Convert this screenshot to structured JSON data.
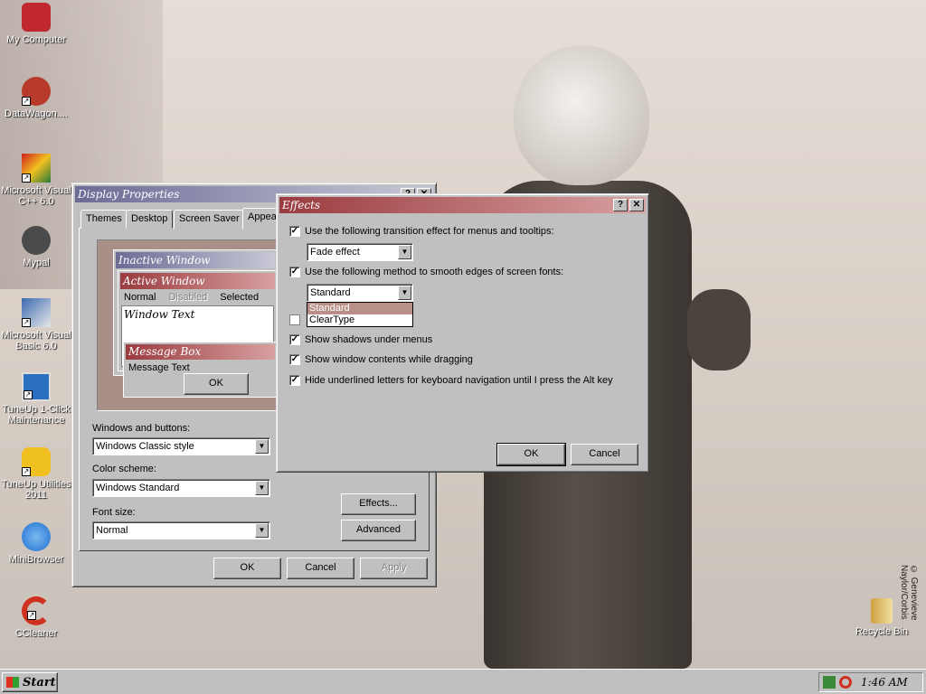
{
  "desktop": {
    "icons": [
      {
        "label": "My Computer",
        "icon": "briefcase-icon",
        "color": "#c0282d"
      },
      {
        "label": "DataWagon....",
        "icon": "shortcut-icon",
        "color": "#b83a2a"
      },
      {
        "label": "Microsoft Visual C++ 6.0",
        "icon": "visual-cpp-icon",
        "color": "#2a7a3a"
      },
      {
        "label": "Mypal",
        "icon": "raccoon-icon",
        "color": "#4a4a4a"
      },
      {
        "label": "Microsoft Visual Basic 6.0",
        "icon": "visual-basic-icon",
        "color": "#3a6ab0"
      },
      {
        "label": "TuneUp 1-Click Maintenance",
        "icon": "monitor-icon",
        "color": "#2a6fc0"
      },
      {
        "label": "TuneUp Utilities 2011",
        "icon": "tuneup-icon",
        "color": "#f0c020"
      },
      {
        "label": "MiniBrowser",
        "icon": "globe-icon",
        "color": "#1f6fd0"
      },
      {
        "label": "CCleaner",
        "icon": "ccleaner-icon",
        "color": "#d03020"
      },
      {
        "label": "Recycle Bin",
        "icon": "recycle-bin-icon",
        "color": "#d0a040"
      }
    ],
    "credit": "© Genevieve Naylor/Corbis"
  },
  "display_properties": {
    "title": "Display Properties",
    "tabs": [
      "Themes",
      "Desktop",
      "Screen Saver",
      "Appea"
    ],
    "preview": {
      "inactive_title": "Inactive Window",
      "active_title": "Active Window",
      "menu_normal": "Normal",
      "menu_disabled": "Disabled",
      "menu_selected": "Selected",
      "window_text": "Window Text",
      "message_box_title": "Message Box",
      "message_text": "Message Text",
      "ok": "OK"
    },
    "windows_buttons_label": "Windows and buttons:",
    "windows_buttons_value": "Windows Classic style",
    "color_scheme_label": "Color scheme:",
    "color_scheme_value": "Windows Standard",
    "font_size_label": "Font size:",
    "font_size_value": "Normal",
    "effects_button": "Effects...",
    "advanced_button": "Advanced",
    "ok": "OK",
    "cancel": "Cancel",
    "apply": "Apply",
    "help_glyph": "?",
    "close_glyph": "✕"
  },
  "effects": {
    "title": "Effects",
    "help_glyph": "?",
    "close_glyph": "✕",
    "transition_label": "Use the following transition effect for menus and tooltips:",
    "transition_value": "Fade effect",
    "smooth_label": "Use the following method to smooth edges of screen fonts:",
    "smooth_value": "Standard",
    "smooth_options": [
      "Standard",
      "ClearType"
    ],
    "shadows_label": "Show shadows under menus",
    "drag_label": "Show window contents while dragging",
    "underline_label": "Hide underlined letters for keyboard navigation until I press the Alt key",
    "check_glyph": "✓",
    "ok": "OK",
    "cancel": "Cancel"
  },
  "taskbar": {
    "start": "Start",
    "clock": "1:46 AM"
  },
  "colors": {
    "title_active_start": "#9a3b3f",
    "title_active_end": "#d8a0a0",
    "title_inactive_start": "#6b6b96",
    "title_inactive_end": "#c9c9d8",
    "selected_item": "#b89088"
  }
}
